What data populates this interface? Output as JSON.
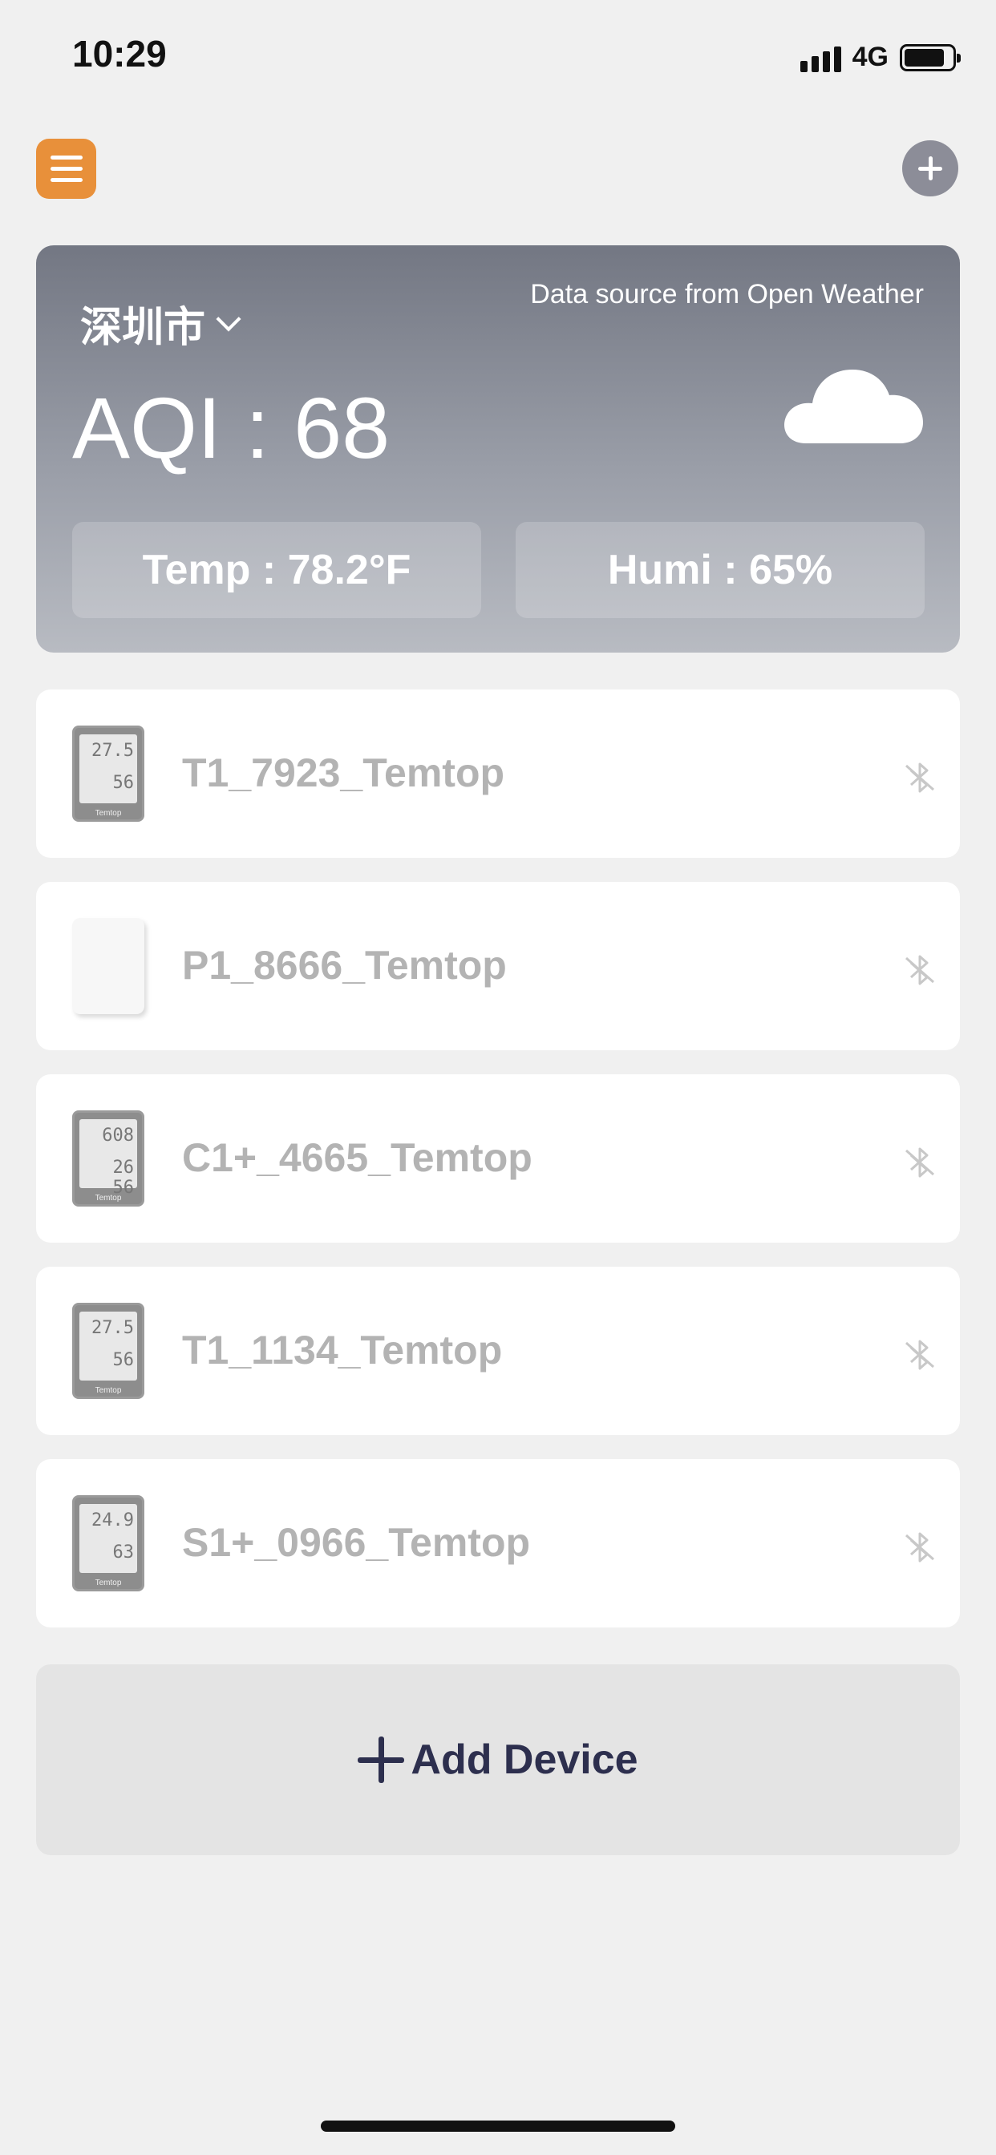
{
  "status_bar": {
    "time": "10:29",
    "network": "4G",
    "battery_level": 0.85
  },
  "weather": {
    "city": "深圳市",
    "source": "Data source from Open Weather",
    "aqi": "AQI : 68",
    "temp": "Temp : 78.2°F",
    "humi": "Humi : 65%",
    "icon": "cloud-icon"
  },
  "devices": [
    {
      "name": "T1_7923_Temtop",
      "type": "lcd",
      "line1": "27.5",
      "line2": "56"
    },
    {
      "name": "P1_8666_Temtop",
      "type": "white"
    },
    {
      "name": "C1+_4665_Temtop",
      "type": "lcd",
      "line1": "608",
      "line2": "26 56"
    },
    {
      "name": "T1_1134_Temtop",
      "type": "lcd",
      "line1": "27.5",
      "line2": "56"
    },
    {
      "name": "S1+_0966_Temtop",
      "type": "lcd",
      "line1": "24.9",
      "line2": "63"
    }
  ],
  "thumb_brand": "Temtop",
  "add_device": {
    "label": "Add Device"
  },
  "colors": {
    "menu_accent": "#e8903a",
    "add_device_text": "#2d2f4e",
    "device_name": "#b3b3b3"
  }
}
